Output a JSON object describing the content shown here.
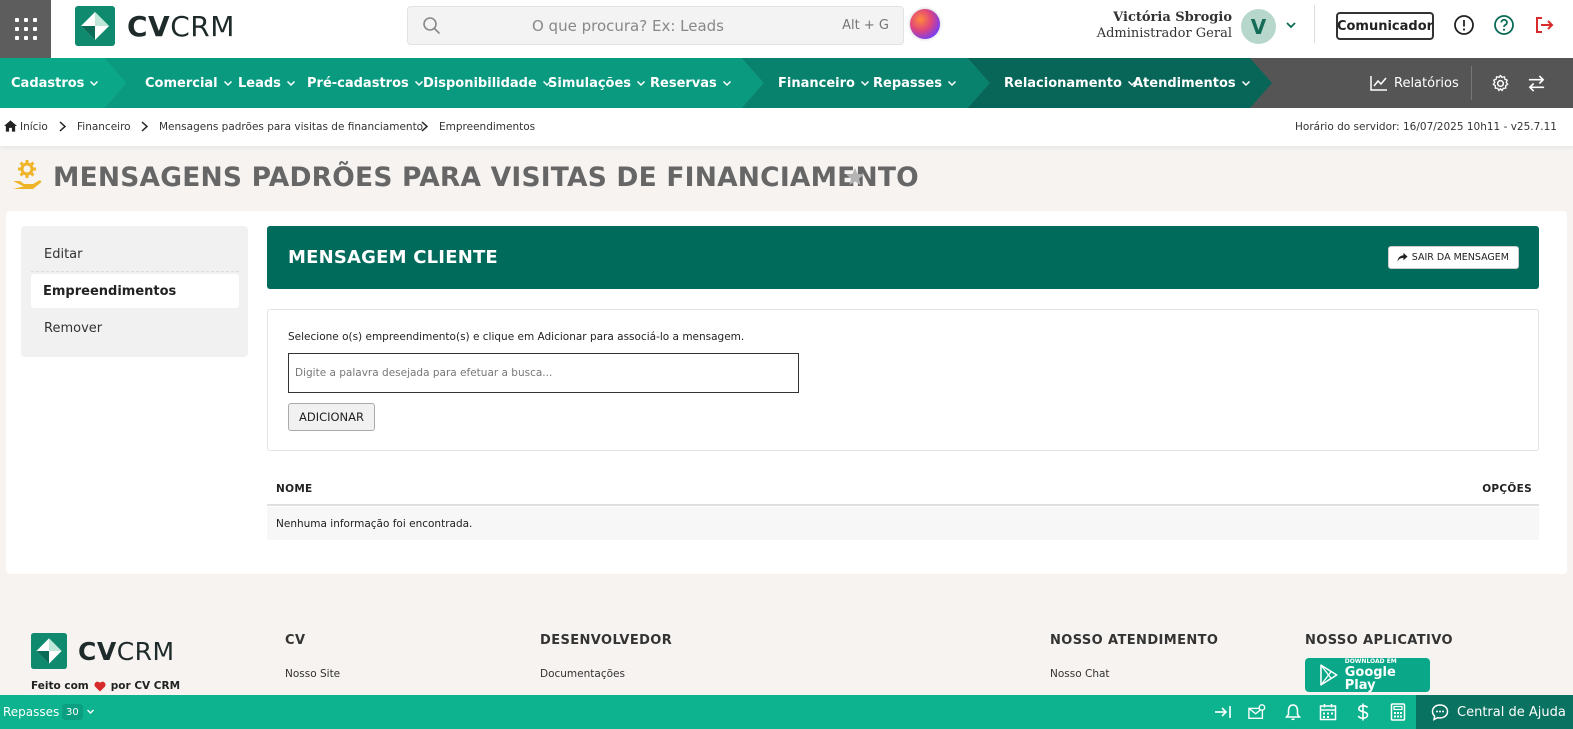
{
  "brand": {
    "name_bold": "CV",
    "name_light": "CRM"
  },
  "search": {
    "placeholder": "O que procura? Ex: Leads",
    "shortcut": "Alt + G"
  },
  "user": {
    "name": "Victória Sbrogio",
    "role": "Administrador Geral",
    "initial": "V"
  },
  "header": {
    "comunicador_label": "Comunicador"
  },
  "nav": {
    "items": [
      {
        "label": "Cadastros"
      },
      {
        "label": "Comercial"
      },
      {
        "label": "Leads"
      },
      {
        "label": "Pré-cadastros"
      },
      {
        "label": "Disponibilidade"
      },
      {
        "label": "Simulações"
      },
      {
        "label": "Reservas"
      },
      {
        "label": "Financeiro"
      },
      {
        "label": "Repasses"
      },
      {
        "label": "Relacionamento"
      },
      {
        "label": "Atendimentos"
      }
    ],
    "reports_label": "Relatórios"
  },
  "breadcrumb": {
    "items": [
      "Início",
      "Financeiro",
      "Mensagens padrões para visitas de financiamento",
      "Empreendimentos"
    ],
    "server_time": "Horário do servidor: 16/07/2025 10h11 - v25.7.11"
  },
  "page": {
    "title": "MENSAGENS PADRÕES PARA VISITAS DE FINANCIAMENTO"
  },
  "sidemenu": {
    "items": [
      {
        "label": "Editar"
      },
      {
        "label": "Empreendimentos"
      },
      {
        "label": "Remover"
      }
    ]
  },
  "message": {
    "title": "MENSAGEM CLIENTE",
    "exit_label": "SAIR DA MENSAGEM"
  },
  "form": {
    "hint": "Selecione o(s) empreendimento(s) e clique em Adicionar para associá-lo a mensagem.",
    "placeholder": "Digite a palavra desejada para efetuar a busca...",
    "add_label": "ADICIONAR"
  },
  "table": {
    "columns": [
      "NOME",
      "OPÇÕES"
    ],
    "empty_text": "Nenhuma informação foi encontrada."
  },
  "footer": {
    "made_with_prefix": "Feito com",
    "made_with_suffix": "por CV CRM",
    "columns": [
      {
        "title": "CV",
        "link": "Nosso Site"
      },
      {
        "title": "DESENVOLVEDOR",
        "link": "Documentações"
      },
      {
        "title": "NOSSO ATENDIMENTO",
        "link": "Nosso Chat"
      },
      {
        "title": "NOSSO APLICATIVO",
        "link": ""
      }
    ],
    "gplay_small": "DOWNLOAD EM",
    "gplay_big": "Google Play"
  },
  "statusbar": {
    "repasses_label": "Repasses",
    "repasses_count": "30",
    "help_label": "Central de Ajuda"
  },
  "colors": {
    "nav_green_1": "#0aa888",
    "nav_green_2": "#0a9a80",
    "nav_green_3": "#076e5e",
    "header_green": "#006a5b",
    "status_green": "#0db38f",
    "accent_red": "#d72b2b"
  }
}
